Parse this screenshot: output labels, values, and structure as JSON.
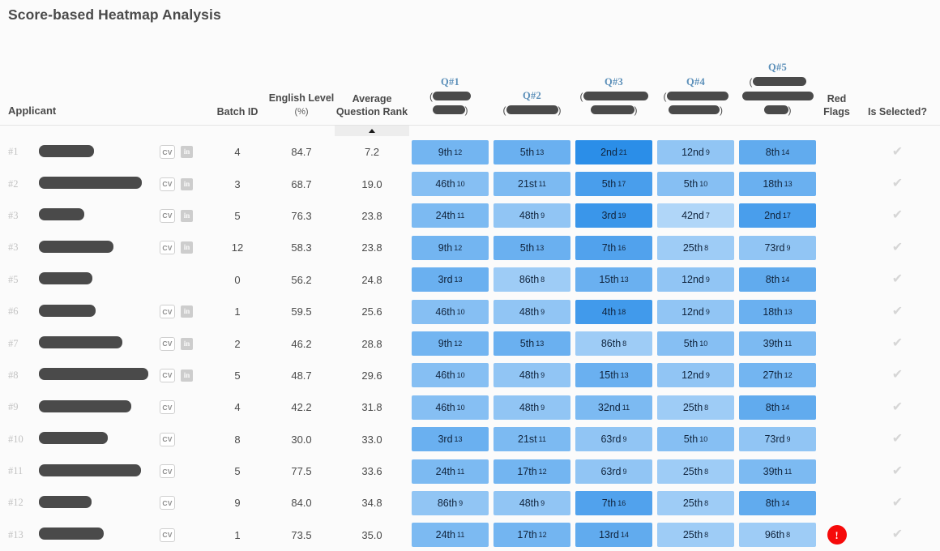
{
  "page": {
    "title": "Score-based Heatmap Analysis"
  },
  "colors": {
    "accent_question": "#5b8fb9",
    "heat_min": "#a8d4f7",
    "heat_max": "#2f8fe8",
    "red_flag": "#f60a0a",
    "check": "#d6d6d6",
    "redaction": "#4a4a4a",
    "page_bg": "#fbfbfb"
  },
  "table": {
    "columns": [
      {
        "key": "applicant",
        "label": "Applicant",
        "unit": ""
      },
      {
        "key": "batch_id",
        "label": "Batch ID",
        "unit": ""
      },
      {
        "key": "english_level",
        "label": "English Level",
        "unit": "(%)"
      },
      {
        "key": "avg_rank",
        "label": "Average Question Rank",
        "unit": "",
        "sorted": "asc"
      },
      {
        "key": "q1",
        "label": "Q#1",
        "unit": "",
        "redacted": true
      },
      {
        "key": "q2",
        "label": "Q#2",
        "unit": "",
        "redacted": true
      },
      {
        "key": "q3",
        "label": "Q#3",
        "unit": "",
        "redacted": true
      },
      {
        "key": "q4",
        "label": "Q#4",
        "unit": "",
        "redacted": true
      },
      {
        "key": "q5",
        "label": "Q#5",
        "unit": "",
        "redacted": true
      },
      {
        "key": "red_flags",
        "label": "Red Flags",
        "unit": ""
      },
      {
        "key": "is_selected",
        "label": "Is Selected?",
        "unit": ""
      }
    ],
    "sort_indicator": "ascending",
    "icons": {
      "cv": "CV",
      "linkedin": "in",
      "check": "✔",
      "flag": "!"
    },
    "rows": [
      {
        "rank": "#1",
        "name_redacted_width": 68,
        "cv": true,
        "linkedin": true,
        "batch_id": "4",
        "english_level": "84.7",
        "avg_rank": "7.2",
        "cells": [
          {
            "rank": "9th",
            "score": 12
          },
          {
            "rank": "5th",
            "score": 13
          },
          {
            "rank": "2nd",
            "score": 21
          },
          {
            "rank": "12nd",
            "score": 9
          },
          {
            "rank": "8th",
            "score": 14
          }
        ],
        "red_flag": false,
        "selected": true
      },
      {
        "rank": "#2",
        "name_redacted_width": 127,
        "cv": true,
        "linkedin": true,
        "batch_id": "3",
        "english_level": "68.7",
        "avg_rank": "19.0",
        "cells": [
          {
            "rank": "46th",
            "score": 10
          },
          {
            "rank": "21st",
            "score": 11
          },
          {
            "rank": "5th",
            "score": 17
          },
          {
            "rank": "5th",
            "score": 10
          },
          {
            "rank": "18th",
            "score": 13
          }
        ],
        "red_flag": false,
        "selected": true
      },
      {
        "rank": "#3",
        "name_redacted_width": 56,
        "cv": true,
        "linkedin": true,
        "batch_id": "5",
        "english_level": "76.3",
        "avg_rank": "23.8",
        "cells": [
          {
            "rank": "24th",
            "score": 11
          },
          {
            "rank": "48th",
            "score": 9
          },
          {
            "rank": "3rd",
            "score": 19
          },
          {
            "rank": "42nd",
            "score": 7
          },
          {
            "rank": "2nd",
            "score": 17
          }
        ],
        "red_flag": false,
        "selected": true
      },
      {
        "rank": "#3",
        "name_redacted_width": 92,
        "cv": true,
        "linkedin": true,
        "batch_id": "12",
        "english_level": "58.3",
        "avg_rank": "23.8",
        "cells": [
          {
            "rank": "9th",
            "score": 12
          },
          {
            "rank": "5th",
            "score": 13
          },
          {
            "rank": "7th",
            "score": 16
          },
          {
            "rank": "25th",
            "score": 8
          },
          {
            "rank": "73rd",
            "score": 9
          }
        ],
        "red_flag": false,
        "selected": true
      },
      {
        "rank": "#5",
        "name_redacted_width": 66,
        "cv": false,
        "linkedin": false,
        "batch_id": "0",
        "english_level": "56.2",
        "avg_rank": "24.8",
        "cells": [
          {
            "rank": "3rd",
            "score": 13
          },
          {
            "rank": "86th",
            "score": 8
          },
          {
            "rank": "15th",
            "score": 13
          },
          {
            "rank": "12nd",
            "score": 9
          },
          {
            "rank": "8th",
            "score": 14
          }
        ],
        "red_flag": false,
        "selected": true
      },
      {
        "rank": "#6",
        "name_redacted_width": 70,
        "cv": true,
        "linkedin": true,
        "batch_id": "1",
        "english_level": "59.5",
        "avg_rank": "25.6",
        "cells": [
          {
            "rank": "46th",
            "score": 10
          },
          {
            "rank": "48th",
            "score": 9
          },
          {
            "rank": "4th",
            "score": 18
          },
          {
            "rank": "12nd",
            "score": 9
          },
          {
            "rank": "18th",
            "score": 13
          }
        ],
        "red_flag": false,
        "selected": true
      },
      {
        "rank": "#7",
        "name_redacted_width": 103,
        "cv": true,
        "linkedin": true,
        "batch_id": "2",
        "english_level": "46.2",
        "avg_rank": "28.8",
        "cells": [
          {
            "rank": "9th",
            "score": 12
          },
          {
            "rank": "5th",
            "score": 13
          },
          {
            "rank": "86th",
            "score": 8
          },
          {
            "rank": "5th",
            "score": 10
          },
          {
            "rank": "39th",
            "score": 11
          }
        ],
        "red_flag": false,
        "selected": true
      },
      {
        "rank": "#8",
        "name_redacted_width": 135,
        "cv": true,
        "linkedin": true,
        "batch_id": "5",
        "english_level": "48.7",
        "avg_rank": "29.6",
        "cells": [
          {
            "rank": "46th",
            "score": 10
          },
          {
            "rank": "48th",
            "score": 9
          },
          {
            "rank": "15th",
            "score": 13
          },
          {
            "rank": "12nd",
            "score": 9
          },
          {
            "rank": "27th",
            "score": 12
          }
        ],
        "red_flag": false,
        "selected": true
      },
      {
        "rank": "#9",
        "name_redacted_width": 114,
        "cv": true,
        "linkedin": false,
        "batch_id": "4",
        "english_level": "42.2",
        "avg_rank": "31.8",
        "cells": [
          {
            "rank": "46th",
            "score": 10
          },
          {
            "rank": "48th",
            "score": 9
          },
          {
            "rank": "32nd",
            "score": 11
          },
          {
            "rank": "25th",
            "score": 8
          },
          {
            "rank": "8th",
            "score": 14
          }
        ],
        "red_flag": false,
        "selected": true
      },
      {
        "rank": "#10",
        "name_redacted_width": 85,
        "cv": true,
        "linkedin": false,
        "batch_id": "8",
        "english_level": "30.0",
        "avg_rank": "33.0",
        "cells": [
          {
            "rank": "3rd",
            "score": 13
          },
          {
            "rank": "21st",
            "score": 11
          },
          {
            "rank": "63rd",
            "score": 9
          },
          {
            "rank": "5th",
            "score": 10
          },
          {
            "rank": "73rd",
            "score": 9
          }
        ],
        "red_flag": false,
        "selected": true
      },
      {
        "rank": "#11",
        "name_redacted_width": 126,
        "cv": true,
        "linkedin": false,
        "batch_id": "5",
        "english_level": "77.5",
        "avg_rank": "33.6",
        "cells": [
          {
            "rank": "24th",
            "score": 11
          },
          {
            "rank": "17th",
            "score": 12
          },
          {
            "rank": "63rd",
            "score": 9
          },
          {
            "rank": "25th",
            "score": 8
          },
          {
            "rank": "39th",
            "score": 11
          }
        ],
        "red_flag": false,
        "selected": true
      },
      {
        "rank": "#12",
        "name_redacted_width": 65,
        "cv": true,
        "linkedin": false,
        "batch_id": "9",
        "english_level": "84.0",
        "avg_rank": "34.8",
        "cells": [
          {
            "rank": "86th",
            "score": 9
          },
          {
            "rank": "48th",
            "score": 9
          },
          {
            "rank": "7th",
            "score": 16
          },
          {
            "rank": "25th",
            "score": 8
          },
          {
            "rank": "8th",
            "score": 14
          }
        ],
        "red_flag": false,
        "selected": true
      },
      {
        "rank": "#13",
        "name_redacted_width": 80,
        "cv": true,
        "linkedin": false,
        "batch_id": "1",
        "english_level": "73.5",
        "avg_rank": "35.0",
        "cells": [
          {
            "rank": "24th",
            "score": 11
          },
          {
            "rank": "17th",
            "score": 12
          },
          {
            "rank": "13rd",
            "score": 14
          },
          {
            "rank": "25th",
            "score": 8
          },
          {
            "rank": "96th",
            "score": 8
          }
        ],
        "red_flag": true,
        "selected": true
      }
    ]
  },
  "header_redactions": {
    "q1": [
      {
        "w": 47,
        "open": true,
        "close": false
      },
      {
        "w": 40,
        "open": false,
        "close": true
      }
    ],
    "q2": [
      {
        "w": 64,
        "open": true,
        "close": true
      }
    ],
    "q3": [
      {
        "w": 80,
        "open": true,
        "close": false
      },
      {
        "w": 54,
        "open": false,
        "close": true
      }
    ],
    "q4": [
      {
        "w": 76,
        "open": true,
        "close": false
      },
      {
        "w": 63,
        "open": false,
        "close": true
      }
    ],
    "q5": [
      {
        "w": 66,
        "open": true,
        "close": false
      },
      {
        "w": 88,
        "open": false,
        "close": false
      },
      {
        "w": 30,
        "open": false,
        "close": true
      }
    ]
  }
}
